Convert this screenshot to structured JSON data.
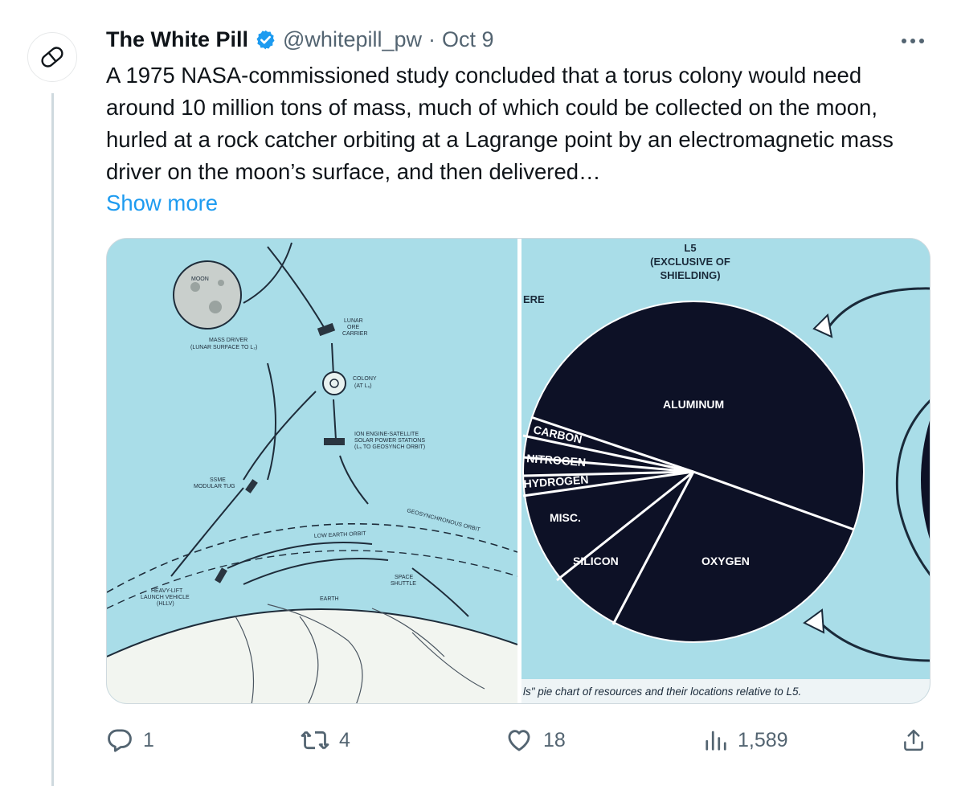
{
  "tweet": {
    "author_name": "The White Pill",
    "verified": true,
    "handle": "@whitepill_pw",
    "separator": "·",
    "date": "Oct 9",
    "text": "A 1975 NASA-commissioned study concluded that a torus colony would need around 10 million tons of mass, much of which could be collected on the moon, hurled at a rock catcher orbiting at a Lagrange point by an electromagnetic mass driver on the moon’s surface, and then delivered…",
    "show_more": "Show more",
    "avatar_icon": "pill-icon",
    "more_icon": "more-horizontal-icon"
  },
  "media": {
    "left_image": {
      "moon": "MOON",
      "mass_driver": [
        "MASS DRIVER",
        "(LUNAR SURFACE TO L₂)"
      ],
      "lunar_ore_carrier": [
        "LUNAR",
        "ORE",
        "CARRIER"
      ],
      "colony": [
        "COLONY",
        "(AT L₅)"
      ],
      "ion_engine": [
        "ION ENGINE-SATELLITE",
        "SOLAR POWER STATIONS",
        "(L₅ TO GEOSYNCH ORBIT)"
      ],
      "ssme": [
        "SSME",
        "MODULAR TUG"
      ],
      "geo_orbit": "GEOSYNCHRONOUS ORBIT",
      "leo": "LOW EARTH ORBIT",
      "shuttle": [
        "SPACE",
        "SHUTTLE"
      ],
      "hllv": [
        "HEAVY-LIFT",
        "LAUNCH VEHICLE",
        "(HLLV)"
      ],
      "earth": "EARTH"
    },
    "right_image": {
      "header": [
        "L5",
        "(EXCLUSIVE OF",
        "SHIELDING)"
      ],
      "corner_text": "ERE",
      "caption": "ls\" pie chart of resources and their locations relative to L5.",
      "pie_labels": {
        "aluminum": "ALUMINUM",
        "carbon": "CARBON",
        "nitrogen": "NITROGEN",
        "hydrogen": "HYDROGEN",
        "misc": "MISC.",
        "silicon": "SILICON",
        "oxygen": "OXYGEN"
      }
    }
  },
  "actions": {
    "reply_count": "1",
    "retweet_count": "4",
    "like_count": "18",
    "views_count": "1,589"
  },
  "colors": {
    "accent": "#1d9bf0",
    "text_secondary": "#536471",
    "diagram_bg": "#a9dde8",
    "pie_fill": "#0d1126"
  }
}
